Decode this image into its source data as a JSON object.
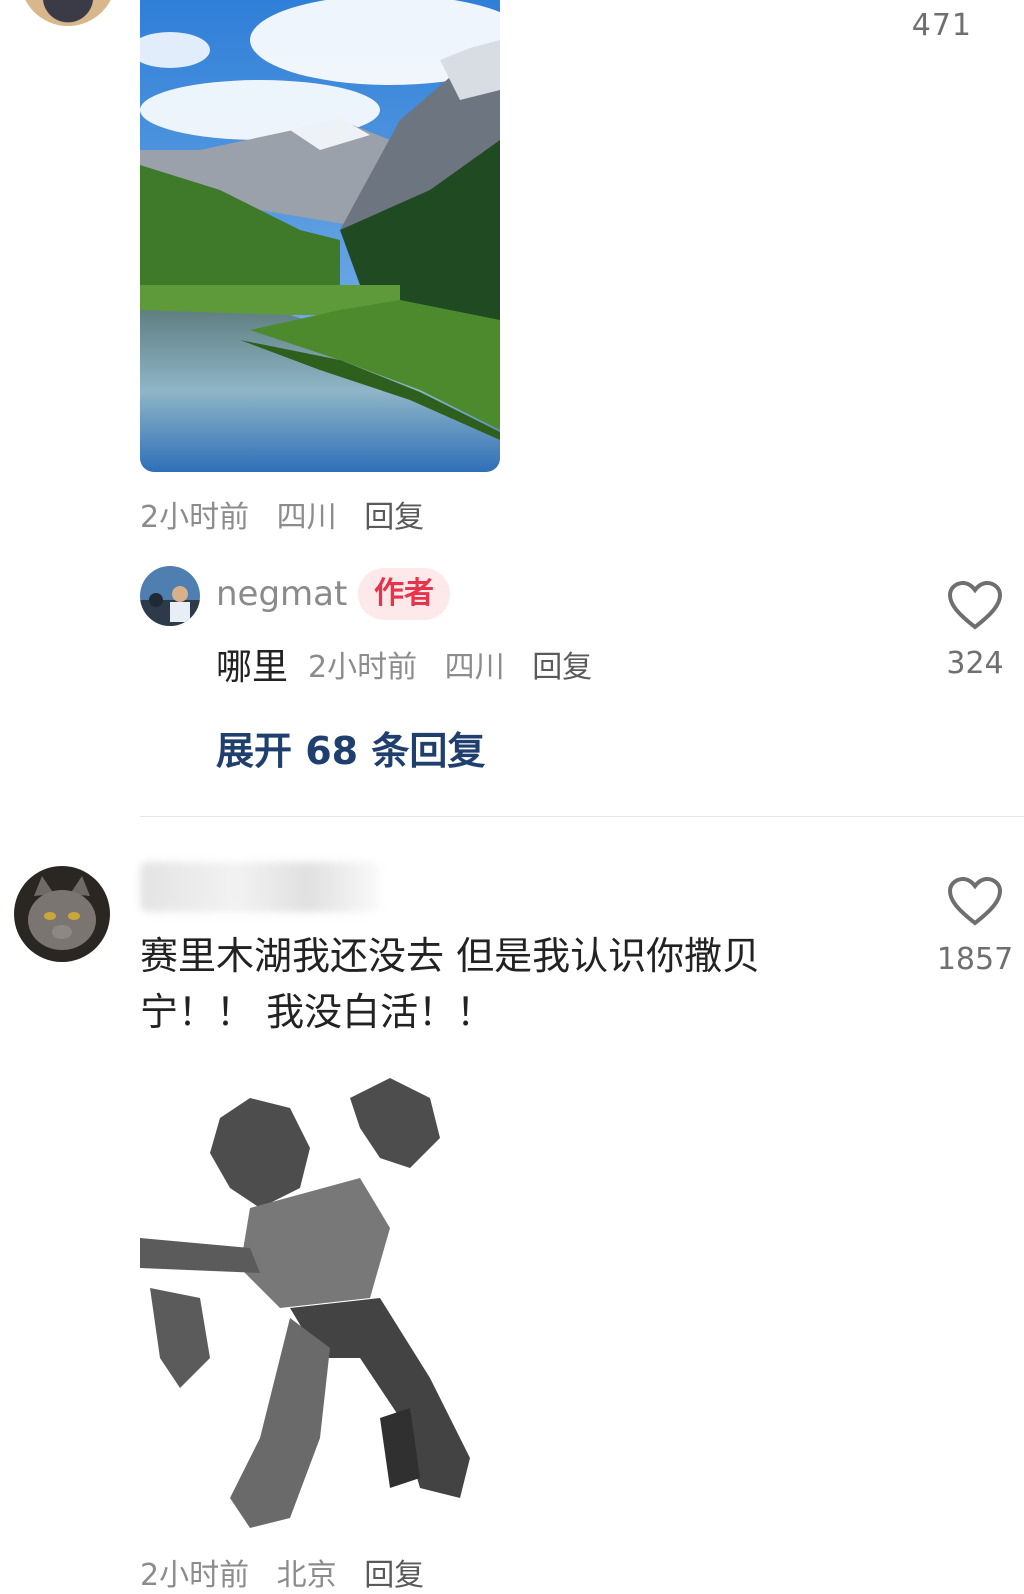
{
  "top_comment": {
    "like_count": "471",
    "meta": {
      "time": "2小时前",
      "location": "四川",
      "reply": "回复"
    }
  },
  "reply": {
    "username": "negmat",
    "badge": "作者",
    "text": "哪里",
    "meta": {
      "time": "2小时前",
      "location": "四川",
      "reply": "回复"
    },
    "like_count": "324"
  },
  "expand_replies": "展开 68 条回复",
  "second_comment": {
    "text": "赛里木湖我还没去 但是我认识你撒贝宁！！ 我没白活！！",
    "like_count": "1857",
    "meta": {
      "time": "2小时前",
      "location": "北京",
      "reply": "回复"
    }
  },
  "colors": {
    "author_badge": "#e8344a",
    "link": "#1f3f6e"
  },
  "icons": [
    "heart-icon"
  ]
}
